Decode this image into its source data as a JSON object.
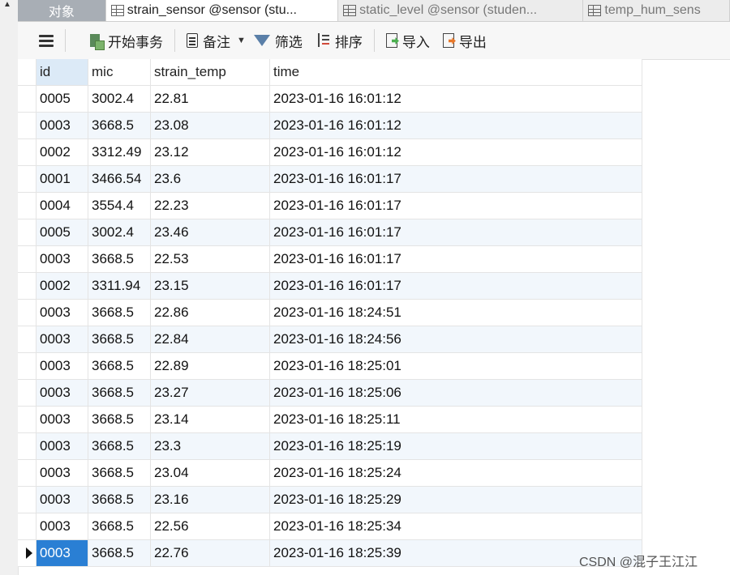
{
  "tabs": {
    "objects": "对象",
    "items": [
      {
        "label": "strain_sensor @sensor (stu..."
      },
      {
        "label": "static_level @sensor (studen..."
      },
      {
        "label": "temp_hum_sens"
      }
    ]
  },
  "toolbar": {
    "begin_transaction": "开始事务",
    "note": "备注",
    "filter": "筛选",
    "sort": "排序",
    "import": "导入",
    "export": "导出"
  },
  "table": {
    "columns": [
      "id",
      "mic",
      "strain_temp",
      "time"
    ],
    "rows": [
      [
        "0005",
        "3002.4",
        "22.81",
        "2023-01-16 16:01:12"
      ],
      [
        "0003",
        "3668.5",
        "23.08",
        "2023-01-16 16:01:12"
      ],
      [
        "0002",
        "3312.49",
        "23.12",
        "2023-01-16 16:01:12"
      ],
      [
        "0001",
        "3466.54",
        "23.6",
        "2023-01-16 16:01:17"
      ],
      [
        "0004",
        "3554.4",
        "22.23",
        "2023-01-16 16:01:17"
      ],
      [
        "0005",
        "3002.4",
        "23.46",
        "2023-01-16 16:01:17"
      ],
      [
        "0003",
        "3668.5",
        "22.53",
        "2023-01-16 16:01:17"
      ],
      [
        "0002",
        "3311.94",
        "23.15",
        "2023-01-16 16:01:17"
      ],
      [
        "0003",
        "3668.5",
        "22.86",
        "2023-01-16 18:24:51"
      ],
      [
        "0003",
        "3668.5",
        "22.84",
        "2023-01-16 18:24:56"
      ],
      [
        "0003",
        "3668.5",
        "22.89",
        "2023-01-16 18:25:01"
      ],
      [
        "0003",
        "3668.5",
        "23.27",
        "2023-01-16 18:25:06"
      ],
      [
        "0003",
        "3668.5",
        "23.14",
        "2023-01-16 18:25:11"
      ],
      [
        "0003",
        "3668.5",
        "23.3",
        "2023-01-16 18:25:19"
      ],
      [
        "0003",
        "3668.5",
        "23.04",
        "2023-01-16 18:25:24"
      ],
      [
        "0003",
        "3668.5",
        "23.16",
        "2023-01-16 18:25:29"
      ],
      [
        "0003",
        "3668.5",
        "22.56",
        "2023-01-16 18:25:34"
      ],
      [
        "0003",
        "3668.5",
        "22.76",
        "2023-01-16 18:25:39"
      ]
    ],
    "selected_row": 17
  },
  "watermark": "CSDN @混子王江江",
  "colors": {
    "selection": "#2a7fd4",
    "alt_row": "#f2f7fc",
    "tab_objects": "#a8aeb5"
  }
}
